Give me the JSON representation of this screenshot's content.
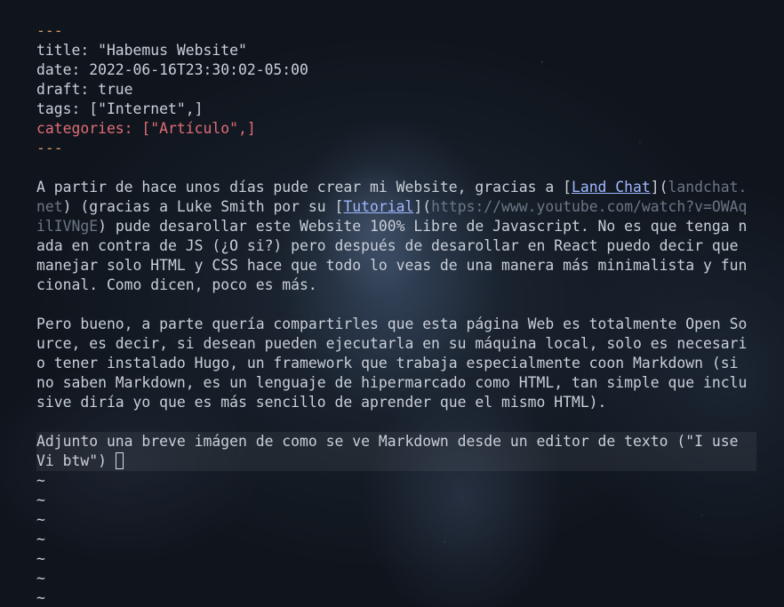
{
  "frontmatter": {
    "open_delim": "---",
    "title": "title: \"Habemus Website\"",
    "date": "date: 2022-06-16T23:30:02-05:00",
    "draft": "draft: true",
    "tags": "tags: [\"Internet\",]",
    "categories": "categories: [\"Artículo\",]",
    "close_delim": "---"
  },
  "p1": {
    "l1_pre": "A partir de hace unos días pude crear mi Website, gracias a [",
    "l1_link": "Land Chat",
    "l1_mid": "](",
    "l1_url": "landchat.",
    "l2_url": "net",
    "l2_mid": ") (gracias a Luke Smith por su [",
    "l2_link": "Tutorial",
    "l2_mid2": "](",
    "l2_url2": "https://www.youtube.com/watch?v=OWAq",
    "l3_url": "ilIVNgE",
    "l3_post": ") pude desarollar este Website 100% Libre de Javascript. No es que tenga n",
    "l4": "ada en contra de JS (¿O si?) pero después de desarollar en React puedo decir que",
    "l5": "manejar solo HTML y CSS hace que todo lo veas de una manera más minimalista y fun",
    "l6": "cional. Como dicen, poco es más."
  },
  "p2": {
    "l1": "Pero bueno, a parte quería compartirles que esta página Web es totalmente Open So",
    "l2": "urce, es decir, si desean pueden ejecutarla en su máquina local, solo es necesari",
    "l3": "o tener instalado Hugo, un framework que trabaja especialmente coon Markdown (si",
    "l4": "no saben Markdown, es un lenguaje de hipermarcado como HTML, tan simple que inclu",
    "l5": "sive diría yo que es más sencillo de aprender que el mismo HTML)."
  },
  "p3": {
    "l1": "Adjunto una breve imágen de como se ve Markdown desde un editor de texto (\"I use",
    "l2": "Vi btw\") "
  },
  "empty_line_marker": "~",
  "colors": {
    "delimiter": "#d19a66",
    "category": "#e06c75",
    "link": "#9fb7ff",
    "url": "#6b7686",
    "text": "#c9cfd8"
  }
}
